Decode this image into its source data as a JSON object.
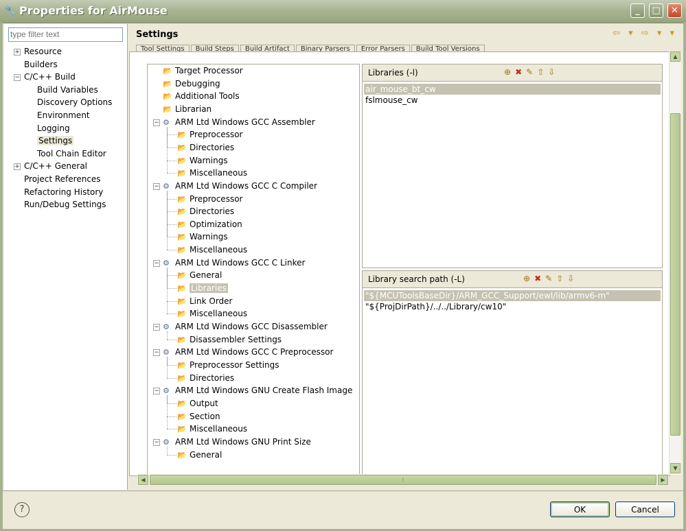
{
  "window": {
    "title": "Properties for AirMouse",
    "icon": "java-properties-icon",
    "minimize": "_",
    "maximize": "□",
    "close": "✕"
  },
  "filter": {
    "placeholder": "type filter text"
  },
  "nav": {
    "items": [
      {
        "label": "Resource",
        "expander": "+",
        "indent": 0
      },
      {
        "label": "Builders",
        "indent": 0
      },
      {
        "label": "C/C++ Build",
        "expander": "−",
        "indent": 0
      },
      {
        "label": "Build Variables",
        "indent": 1
      },
      {
        "label": "Discovery Options",
        "indent": 1
      },
      {
        "label": "Environment",
        "indent": 1
      },
      {
        "label": "Logging",
        "indent": 1
      },
      {
        "label": "Settings",
        "indent": 1,
        "selected": true
      },
      {
        "label": "Tool Chain Editor",
        "indent": 1
      },
      {
        "label": "C/C++ General",
        "expander": "+",
        "indent": 0
      },
      {
        "label": "Project References",
        "indent": 0
      },
      {
        "label": "Refactoring History",
        "indent": 0
      },
      {
        "label": "Run/Debug Settings",
        "indent": 0
      }
    ]
  },
  "page": {
    "title": "Settings",
    "nav_arrows": "⇦ ▾ ⇨ ▾ ▾"
  },
  "tabs": [
    "Tool Settings",
    "Build Steps",
    "Build Artifact",
    "Binary Parsers",
    "Error Parsers",
    "Build Tool Versions"
  ],
  "tree": {
    "items": [
      {
        "label": "Target Processor",
        "level": 0,
        "icon": "settings-folder-icon"
      },
      {
        "label": "Debugging",
        "level": 0,
        "icon": "settings-folder-icon"
      },
      {
        "label": "Additional Tools",
        "level": 0,
        "icon": "settings-folder-icon"
      },
      {
        "label": "Librarian",
        "level": 0,
        "icon": "settings-folder-icon"
      },
      {
        "label": "ARM Ltd Windows GCC Assembler",
        "level": 0,
        "icon": "tool-gear-icon",
        "expander": "−"
      },
      {
        "label": "Preprocessor",
        "level": 1,
        "icon": "settings-folder-icon"
      },
      {
        "label": "Directories",
        "level": 1,
        "icon": "settings-folder-icon"
      },
      {
        "label": "Warnings",
        "level": 1,
        "icon": "settings-folder-icon"
      },
      {
        "label": "Miscellaneous",
        "level": 1,
        "icon": "settings-folder-icon"
      },
      {
        "label": "ARM Ltd Windows GCC C Compiler",
        "level": 0,
        "icon": "tool-gear-icon",
        "expander": "−"
      },
      {
        "label": "Preprocessor",
        "level": 1,
        "icon": "settings-folder-icon"
      },
      {
        "label": "Directories",
        "level": 1,
        "icon": "settings-folder-icon"
      },
      {
        "label": "Optimization",
        "level": 1,
        "icon": "settings-folder-icon"
      },
      {
        "label": "Warnings",
        "level": 1,
        "icon": "settings-folder-icon"
      },
      {
        "label": "Miscellaneous",
        "level": 1,
        "icon": "settings-folder-icon"
      },
      {
        "label": "ARM Ltd Windows GCC C Linker",
        "level": 0,
        "icon": "tool-gear-icon",
        "expander": "−"
      },
      {
        "label": "General",
        "level": 1,
        "icon": "settings-folder-icon"
      },
      {
        "label": "Libraries",
        "level": 1,
        "icon": "settings-folder-icon",
        "selected": true
      },
      {
        "label": "Link Order",
        "level": 1,
        "icon": "settings-folder-icon"
      },
      {
        "label": "Miscellaneous",
        "level": 1,
        "icon": "settings-folder-icon"
      },
      {
        "label": "ARM Ltd Windows GCC Disassembler",
        "level": 0,
        "icon": "tool-gear-icon",
        "expander": "−"
      },
      {
        "label": "Disassembler Settings",
        "level": 1,
        "icon": "settings-folder-icon"
      },
      {
        "label": "ARM Ltd Windows GCC C Preprocessor",
        "level": 0,
        "icon": "tool-gear-icon",
        "expander": "−"
      },
      {
        "label": "Preprocessor Settings",
        "level": 1,
        "icon": "settings-folder-icon"
      },
      {
        "label": "Directories",
        "level": 1,
        "icon": "settings-folder-icon"
      },
      {
        "label": "ARM Ltd Windows GNU Create Flash Image",
        "level": 0,
        "icon": "tool-gear-icon",
        "expander": "−"
      },
      {
        "label": "Output",
        "level": 1,
        "icon": "settings-folder-icon"
      },
      {
        "label": "Section",
        "level": 1,
        "icon": "settings-folder-icon"
      },
      {
        "label": "Miscellaneous",
        "level": 1,
        "icon": "settings-folder-icon"
      },
      {
        "label": "ARM Ltd Windows GNU Print Size",
        "level": 0,
        "icon": "tool-gear-icon",
        "expander": "−"
      },
      {
        "label": "General",
        "level": 1,
        "icon": "settings-folder-icon"
      }
    ]
  },
  "libraries": {
    "label": "Libraries (-l)",
    "items": [
      "air_mouse_bt_cw",
      "fslmouse_cw"
    ],
    "selected_index": 0
  },
  "library_paths": {
    "label": "Library search path (-L)",
    "items": [
      "\"${MCUToolsBaseDir}/ARM_GCC_Support/ewl/lib/armv6-m\"",
      "\"${ProjDirPath}/../../Library/cw10\""
    ],
    "selected_index": 0
  },
  "toolbar_icons": [
    "add-icon",
    "delete-icon",
    "edit-icon",
    "move-up-icon",
    "move-down-icon"
  ],
  "buttons": {
    "ok": "OK",
    "cancel": "Cancel",
    "help": "?"
  },
  "colors": {
    "title_bar": "#a9b493",
    "selection": "#c6c2b2",
    "dialog_bg": "#ece9d8"
  }
}
